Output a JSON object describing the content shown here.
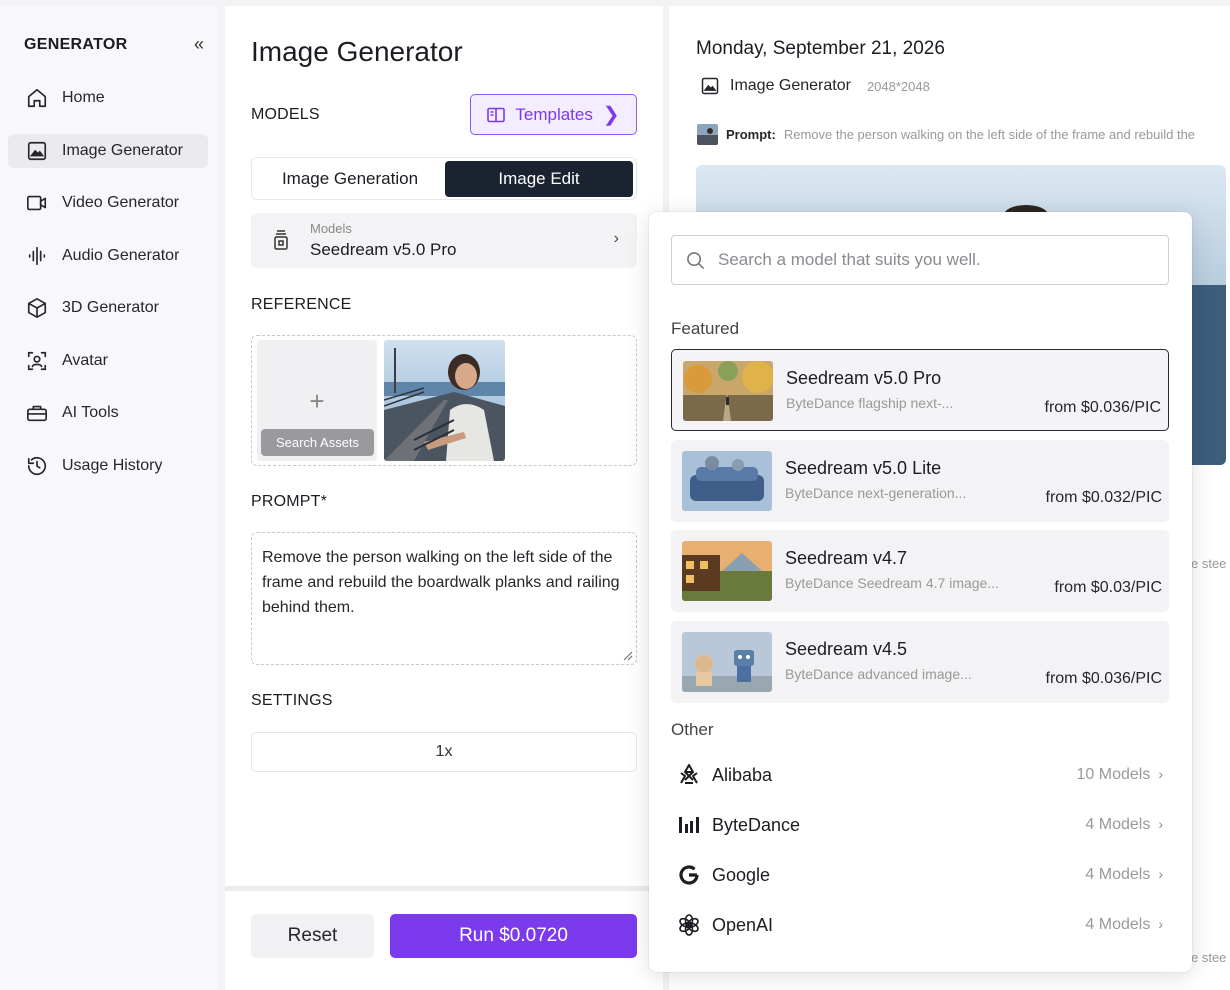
{
  "sidebar": {
    "title": "GENERATOR",
    "collapse_icon": "«",
    "items": [
      {
        "label": "Home",
        "icon": "home-icon"
      },
      {
        "label": "Image Generator",
        "icon": "image-icon",
        "active": true
      },
      {
        "label": "Video Generator",
        "icon": "video-icon"
      },
      {
        "label": "Audio Generator",
        "icon": "audio-icon"
      },
      {
        "label": "3D Generator",
        "icon": "cube-icon"
      },
      {
        "label": "Avatar",
        "icon": "avatar-icon"
      },
      {
        "label": "AI Tools",
        "icon": "toolbox-icon"
      },
      {
        "label": "Usage History",
        "icon": "history-icon"
      }
    ]
  },
  "panel": {
    "title": "Image Generator",
    "models_heading": "MODELS",
    "templates_label": "Templates",
    "tabs": [
      "Image Generation",
      "Image Edit"
    ],
    "active_tab": "Image Edit",
    "model_select_label": "Models",
    "model_select_value": "Seedream v5.0 Pro",
    "reference_heading": "REFERENCE",
    "search_assets_label": "Search Assets",
    "prompt_heading": "PROMPT*",
    "prompt_text": "Remove the person walking on the left side of the frame and rebuild the boardwalk planks and railing behind them.",
    "settings_heading": "SETTINGS",
    "settings_value": "1x",
    "reset_label": "Reset",
    "run_label": "Run $0.0720"
  },
  "result": {
    "date": "Monday, September 21, 2026",
    "generator": "Image Generator",
    "dimensions": "2048*2048",
    "prompt_label": "Prompt:",
    "prompt_text": "Remove the person walking on the left side of the frame and rebuild the",
    "steel_fragment": "e stee"
  },
  "dropdown": {
    "search_placeholder": "Search a model that suits you well.",
    "featured_heading": "Featured",
    "featured": [
      {
        "name": "Seedream v5.0 Pro",
        "desc": "ByteDance flagship next-...",
        "price": "from $0.036/PIC",
        "selected": true
      },
      {
        "name": "Seedream v5.0 Lite",
        "desc": "ByteDance next-generation...",
        "price": "from $0.032/PIC"
      },
      {
        "name": "Seedream v4.7",
        "desc": "ByteDance Seedream 4.7 image...",
        "price": "from $0.03/PIC"
      },
      {
        "name": "Seedream v4.5",
        "desc": "ByteDance advanced image...",
        "price": "from $0.036/PIC"
      }
    ],
    "other_heading": "Other",
    "providers": [
      {
        "name": "Alibaba",
        "count": "10 Models",
        "icon": "alibaba-icon"
      },
      {
        "name": "ByteDance",
        "count": "4 Models",
        "icon": "bytedance-icon"
      },
      {
        "name": "Google",
        "count": "4 Models",
        "icon": "google-icon"
      },
      {
        "name": "OpenAI",
        "count": "4 Models",
        "icon": "openai-icon"
      }
    ]
  },
  "colors": {
    "accent": "#7c3aed",
    "accent_light": "#f3edff",
    "dark_tab": "#1b2230"
  }
}
